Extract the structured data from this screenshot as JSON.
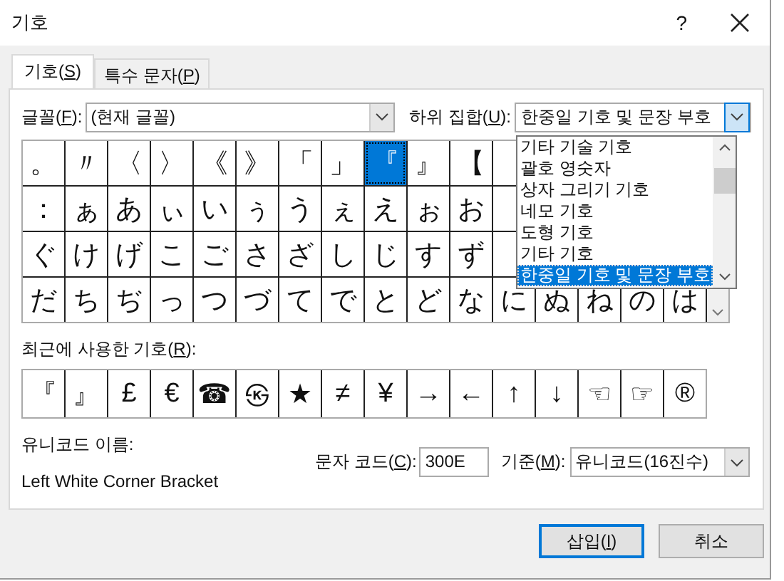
{
  "window": {
    "title": "기호",
    "help": "?"
  },
  "tabs": [
    {
      "pre": "기호(",
      "key": "S",
      "post": ")",
      "selected": true
    },
    {
      "pre": "특수 문자(",
      "key": "P",
      "post": ")",
      "selected": false
    }
  ],
  "font": {
    "label": {
      "pre": "글꼴(",
      "key": "F",
      "post": "):"
    },
    "value": "(현재 글꼴)"
  },
  "subset": {
    "label": {
      "pre": "하위 집합(",
      "key": "U",
      "post": "):"
    },
    "value": "한중일 기호 및 문장 부호",
    "expanded": true,
    "options": [
      {
        "label": "기타 기술 기호",
        "selected": false
      },
      {
        "label": "괄호 영숫자",
        "selected": false
      },
      {
        "label": "상자 그리기 기호",
        "selected": false
      },
      {
        "label": "네모 기호",
        "selected": false
      },
      {
        "label": "도형 기호",
        "selected": false
      },
      {
        "label": "기타 기호",
        "selected": false
      },
      {
        "label": "한중일 기호 및 문장 부호",
        "selected": true
      }
    ]
  },
  "symbols": [
    [
      {
        "char": "。",
        "selected": false
      },
      {
        "char": "〃",
        "selected": false
      },
      {
        "char": "〈",
        "selected": false
      },
      {
        "char": "〉",
        "selected": false
      },
      {
        "char": "《",
        "selected": false
      },
      {
        "char": "》",
        "selected": false
      },
      {
        "char": "「",
        "selected": false
      },
      {
        "char": "」",
        "selected": false
      },
      {
        "char": "『",
        "selected": true
      },
      {
        "char": "』",
        "selected": false
      },
      {
        "char": "【",
        "selected": false
      }
    ],
    [
      {
        "char": "：",
        "selected": false
      },
      {
        "char": "ぁ",
        "selected": false
      },
      {
        "char": "あ",
        "selected": false
      },
      {
        "char": "ぃ",
        "selected": false
      },
      {
        "char": "い",
        "selected": false
      },
      {
        "char": "ぅ",
        "selected": false
      },
      {
        "char": "う",
        "selected": false
      },
      {
        "char": "ぇ",
        "selected": false
      },
      {
        "char": "え",
        "selected": false
      },
      {
        "char": "ぉ",
        "selected": false
      },
      {
        "char": "お",
        "selected": false
      }
    ],
    [
      {
        "char": "ぐ",
        "selected": false
      },
      {
        "char": "け",
        "selected": false
      },
      {
        "char": "げ",
        "selected": false
      },
      {
        "char": "こ",
        "selected": false
      },
      {
        "char": "ご",
        "selected": false
      },
      {
        "char": "さ",
        "selected": false
      },
      {
        "char": "ざ",
        "selected": false
      },
      {
        "char": "し",
        "selected": false
      },
      {
        "char": "じ",
        "selected": false
      },
      {
        "char": "す",
        "selected": false
      },
      {
        "char": "ず",
        "selected": false
      }
    ],
    [
      {
        "char": "だ",
        "selected": false
      },
      {
        "char": "ち",
        "selected": false
      },
      {
        "char": "ぢ",
        "selected": false
      },
      {
        "char": "っ",
        "selected": false
      },
      {
        "char": "つ",
        "selected": false
      },
      {
        "char": "づ",
        "selected": false
      },
      {
        "char": "て",
        "selected": false
      },
      {
        "char": "で",
        "selected": false
      },
      {
        "char": "と",
        "selected": false
      },
      {
        "char": "ど",
        "selected": false
      },
      {
        "char": "な",
        "selected": false
      },
      {
        "char": "に",
        "selected": false
      },
      {
        "char": "ぬ",
        "selected": false
      },
      {
        "char": "ね",
        "selected": false
      },
      {
        "char": "の",
        "selected": false
      },
      {
        "char": "は",
        "selected": false
      }
    ]
  ],
  "recent": {
    "label": {
      "pre": "최근에 사용한 기호(",
      "key": "R",
      "post": "):"
    },
    "symbols": [
      "『",
      "』",
      "£",
      "€",
      "☎",
      "㉿",
      "★",
      "≠",
      "¥",
      "→",
      "←",
      "↑",
      "↓",
      "☜",
      "☞",
      "®"
    ]
  },
  "unicode_name": {
    "label": "유니코드 이름:",
    "value": "Left White Corner Bracket"
  },
  "char_code": {
    "label": {
      "pre": "문자 코드(",
      "key": "C",
      "post": "):"
    },
    "value": "300E"
  },
  "base": {
    "label": {
      "pre": "기준(",
      "key": "M",
      "post": "):"
    },
    "value": "유니코드(16진수)"
  },
  "buttons": [
    {
      "pre": "삽입(",
      "key": "I",
      "post": ")",
      "default": true
    },
    {
      "pre": "취소",
      "default": false
    }
  ]
}
